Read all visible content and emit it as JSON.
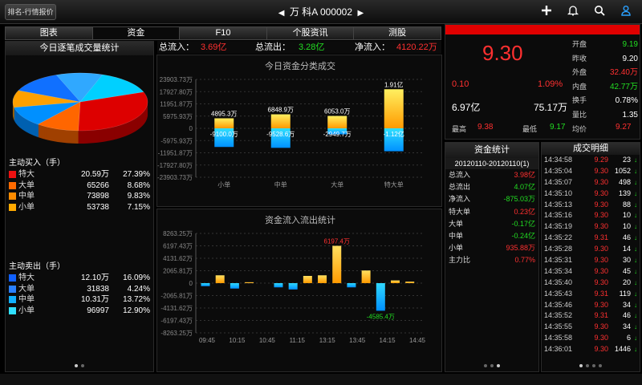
{
  "topbar": {
    "back_label": "排名-行情报价",
    "stock_name": "万 科A",
    "stock_code": "000002",
    "prev_arrow": "◀",
    "next_arrow": "▶",
    "icons": [
      "plus-icon",
      "bell-icon",
      "search-icon",
      "user-icon"
    ]
  },
  "tabs": [
    {
      "label": "图表",
      "active": false
    },
    {
      "label": "资金",
      "active": true
    },
    {
      "label": "F10",
      "active": false
    },
    {
      "label": "个股资讯",
      "active": false
    },
    {
      "label": "测股",
      "active": false
    }
  ],
  "flow_summary": {
    "in_label": "总流入：",
    "in_value": "3.69亿",
    "out_label": "总流出：",
    "out_value": "3.28亿",
    "net_label": "净流入：",
    "net_value": "4120.22万"
  },
  "left_panel": {
    "title": "今日逐笔成交量统计",
    "pie_colors": {
      "special": "#dd0000",
      "large": "#ff6600",
      "medium": "#0090ff",
      "small": "#00d0ff"
    },
    "buy_title": "主动买入（手）",
    "buy_rows": [
      {
        "label": "特大",
        "color": "#ee1111",
        "volume": "20.59万",
        "pct": "27.39%"
      },
      {
        "label": "大单",
        "color": "#ff6a00",
        "volume": "65266",
        "pct": "8.68%"
      },
      {
        "label": "中单",
        "color": "#ff8c00",
        "volume": "73898",
        "pct": "9.83%"
      },
      {
        "label": "小单",
        "color": "#ffaa00",
        "volume": "53738",
        "pct": "7.15%"
      }
    ],
    "sell_title": "主动卖出（手）",
    "sell_rows": [
      {
        "label": "特大",
        "color": "#1060ff",
        "volume": "12.10万",
        "pct": "16.09%"
      },
      {
        "label": "大单",
        "color": "#2a80ff",
        "volume": "31838",
        "pct": "4.24%"
      },
      {
        "label": "中单",
        "color": "#10b0ff",
        "volume": "10.31万",
        "pct": "13.72%"
      },
      {
        "label": "小单",
        "color": "#30e0ff",
        "volume": "96997",
        "pct": "12.90%"
      }
    ]
  },
  "chart_data": [
    {
      "type": "bar",
      "title": "今日资金分类成交",
      "categories": [
        "小单",
        "中单",
        "大单",
        "特大单"
      ],
      "yticks": [
        "23903.73万",
        "17927.80万",
        "11951.87万",
        "5975.93万",
        "0",
        "-5975.93万",
        "-11951.87万",
        "-17927.80万",
        "-23903.73万"
      ],
      "ylim": [
        -23903.73,
        23903.73
      ],
      "series": [
        {
          "name": "流入",
          "values": [
            4895.3,
            6848.9,
            6053.0,
            19100
          ],
          "labels": [
            "4895.3万",
            "6848.9万",
            "6053.0万",
            "1.91亿"
          ]
        },
        {
          "name": "流出",
          "values": [
            -9100.0,
            -9528.6,
            -2949.7,
            -11200
          ],
          "labels": [
            "-9100.0万",
            "-9528.6万",
            "-2949.7万",
            "-1.12亿"
          ]
        }
      ]
    },
    {
      "type": "bar",
      "title": "资金流入流出统计",
      "x": [
        "09:45",
        "10:15",
        "10:45",
        "11:15",
        "13:15",
        "13:45",
        "14:15",
        "14:45"
      ],
      "yticks": [
        "8263.25万",
        "6197.43万",
        "4131.62万",
        "2065.81万",
        "0",
        "-2065.81万",
        "-4131.62万",
        "-6197.43万",
        "-8263.25万"
      ],
      "ylim": [
        -8263.25,
        8263.25
      ],
      "values": [
        -500,
        1300,
        -900,
        150,
        0,
        -700,
        -1050,
        1200,
        1300,
        6197.43,
        -700,
        2100,
        -4585.4,
        450,
        250
      ],
      "annotations": [
        {
          "index": 9,
          "text": "6197.4万"
        },
        {
          "index": 12,
          "text": "-4585.4万"
        }
      ]
    }
  ],
  "quote": {
    "price": "9.30",
    "change": "0.10",
    "change_pct": "1.09%",
    "amount": "6.97亿",
    "volume": "75.17万",
    "high_label": "最高",
    "high": "9.38",
    "low_label": "最低",
    "low": "9.17",
    "avg_label": "均价",
    "avg": "9.27",
    "fields": [
      {
        "label": "开盘",
        "value": "9.19",
        "cls": "green"
      },
      {
        "label": "昨收",
        "value": "9.20",
        "cls": "white"
      },
      {
        "label": "外盘",
        "value": "32.40万",
        "cls": "red"
      },
      {
        "label": "内盘",
        "value": "42.77万",
        "cls": "green"
      },
      {
        "label": "换手",
        "value": "0.78%",
        "cls": "white"
      },
      {
        "label": "量比",
        "value": "1.35",
        "cls": "white"
      }
    ]
  },
  "fund_stats": {
    "title": "资金统计",
    "range": "20120110-20120110(1)",
    "rows": [
      {
        "label": "总流入",
        "value": "3.98亿",
        "cls": "red"
      },
      {
        "label": "总流出",
        "value": "4.07亿",
        "cls": "green"
      },
      {
        "label": "净流入",
        "value": "-875.03万",
        "cls": "green"
      },
      {
        "label": "特大单",
        "value": "0.23亿",
        "cls": "red"
      },
      {
        "label": "大单",
        "value": "-0.17亿",
        "cls": "green"
      },
      {
        "label": "中单",
        "value": "-0.24亿",
        "cls": "green"
      },
      {
        "label": "小单",
        "value": "935.88万",
        "cls": "red"
      },
      {
        "label": "主力比",
        "value": "0.77%",
        "cls": "red"
      }
    ]
  },
  "trade_detail": {
    "title": "成交明细",
    "rows": [
      {
        "time": "14:34:58",
        "price": "9.29",
        "qty": "23",
        "cls": "red"
      },
      {
        "time": "14:35:04",
        "price": "9.30",
        "qty": "1052",
        "cls": "red"
      },
      {
        "time": "14:35:07",
        "price": "9.30",
        "qty": "498",
        "cls": "red"
      },
      {
        "time": "14:35:10",
        "price": "9.30",
        "qty": "139",
        "cls": "red"
      },
      {
        "time": "14:35:13",
        "price": "9.30",
        "qty": "88",
        "cls": "red"
      },
      {
        "time": "14:35:16",
        "price": "9.30",
        "qty": "10",
        "cls": "red"
      },
      {
        "time": "14:35:19",
        "price": "9.30",
        "qty": "10",
        "cls": "red"
      },
      {
        "time": "14:35:22",
        "price": "9.31",
        "qty": "46",
        "cls": "red"
      },
      {
        "time": "14:35:28",
        "price": "9.30",
        "qty": "14",
        "cls": "red"
      },
      {
        "time": "14:35:31",
        "price": "9.30",
        "qty": "30",
        "cls": "red"
      },
      {
        "time": "14:35:34",
        "price": "9.30",
        "qty": "45",
        "cls": "red"
      },
      {
        "time": "14:35:40",
        "price": "9.30",
        "qty": "20",
        "cls": "red"
      },
      {
        "time": "14:35:43",
        "price": "9.31",
        "qty": "119",
        "cls": "red"
      },
      {
        "time": "14:35:46",
        "price": "9.30",
        "qty": "34",
        "cls": "red"
      },
      {
        "time": "14:35:52",
        "price": "9.31",
        "qty": "46",
        "cls": "red"
      },
      {
        "time": "14:35:55",
        "price": "9.30",
        "qty": "34",
        "cls": "red"
      },
      {
        "time": "14:35:58",
        "price": "9.30",
        "qty": "6",
        "cls": "red"
      },
      {
        "time": "14:36:01",
        "price": "9.30",
        "qty": "1446",
        "cls": "red"
      }
    ]
  }
}
